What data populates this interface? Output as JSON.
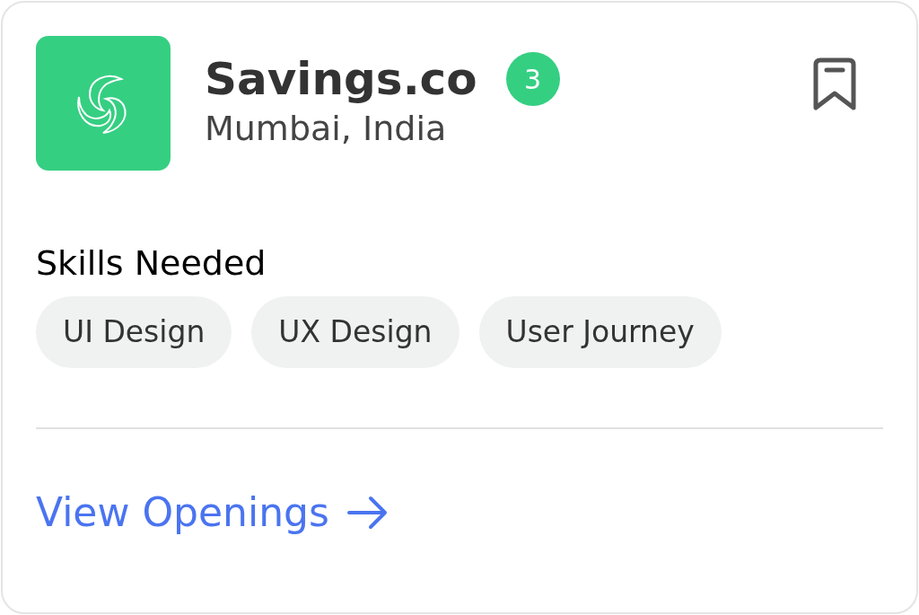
{
  "company": {
    "name": "Savings.co",
    "badge": "3",
    "location": "Mumbai, India"
  },
  "skills": {
    "title": "Skills Needed",
    "tags": [
      "UI Design",
      "UX Design",
      "User Journey"
    ]
  },
  "link": {
    "label": "View Openings"
  }
}
